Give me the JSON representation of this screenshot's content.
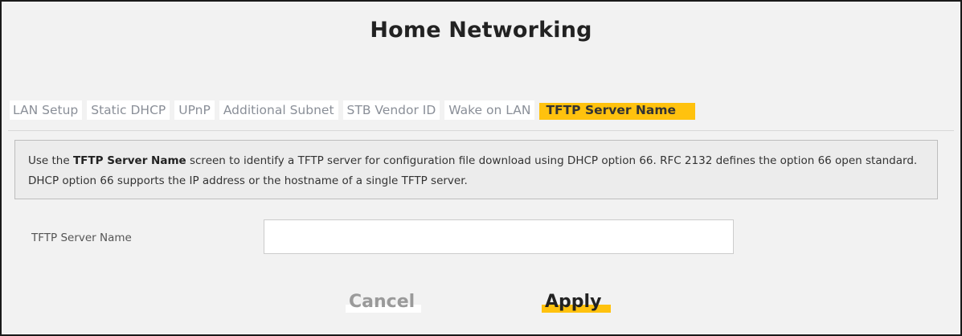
{
  "page": {
    "title": "Home Networking"
  },
  "tabs": [
    {
      "label": "LAN Setup",
      "active": false
    },
    {
      "label": "Static DHCP",
      "active": false
    },
    {
      "label": "UPnP",
      "active": false
    },
    {
      "label": "Additional Subnet",
      "active": false
    },
    {
      "label": "STB Vendor ID",
      "active": false
    },
    {
      "label": "Wake on LAN",
      "active": false
    },
    {
      "label": "TFTP Server Name",
      "active": true
    }
  ],
  "info": {
    "prefix": "Use the ",
    "bold": "TFTP Server Name",
    "rest": " screen to identify a TFTP server for configuration file download using DHCP option 66. RFC 2132 defines the option 66 open standard. DHCP option 66 supports the IP address or the hostname of a single TFTP server."
  },
  "form": {
    "tftp_label": "TFTP Server Name",
    "tftp_value": ""
  },
  "buttons": {
    "cancel": "Cancel",
    "apply": "Apply"
  },
  "colors": {
    "accent": "#ffc20e",
    "panel_bg": "#f2f2f2",
    "info_bg": "#ececec"
  }
}
